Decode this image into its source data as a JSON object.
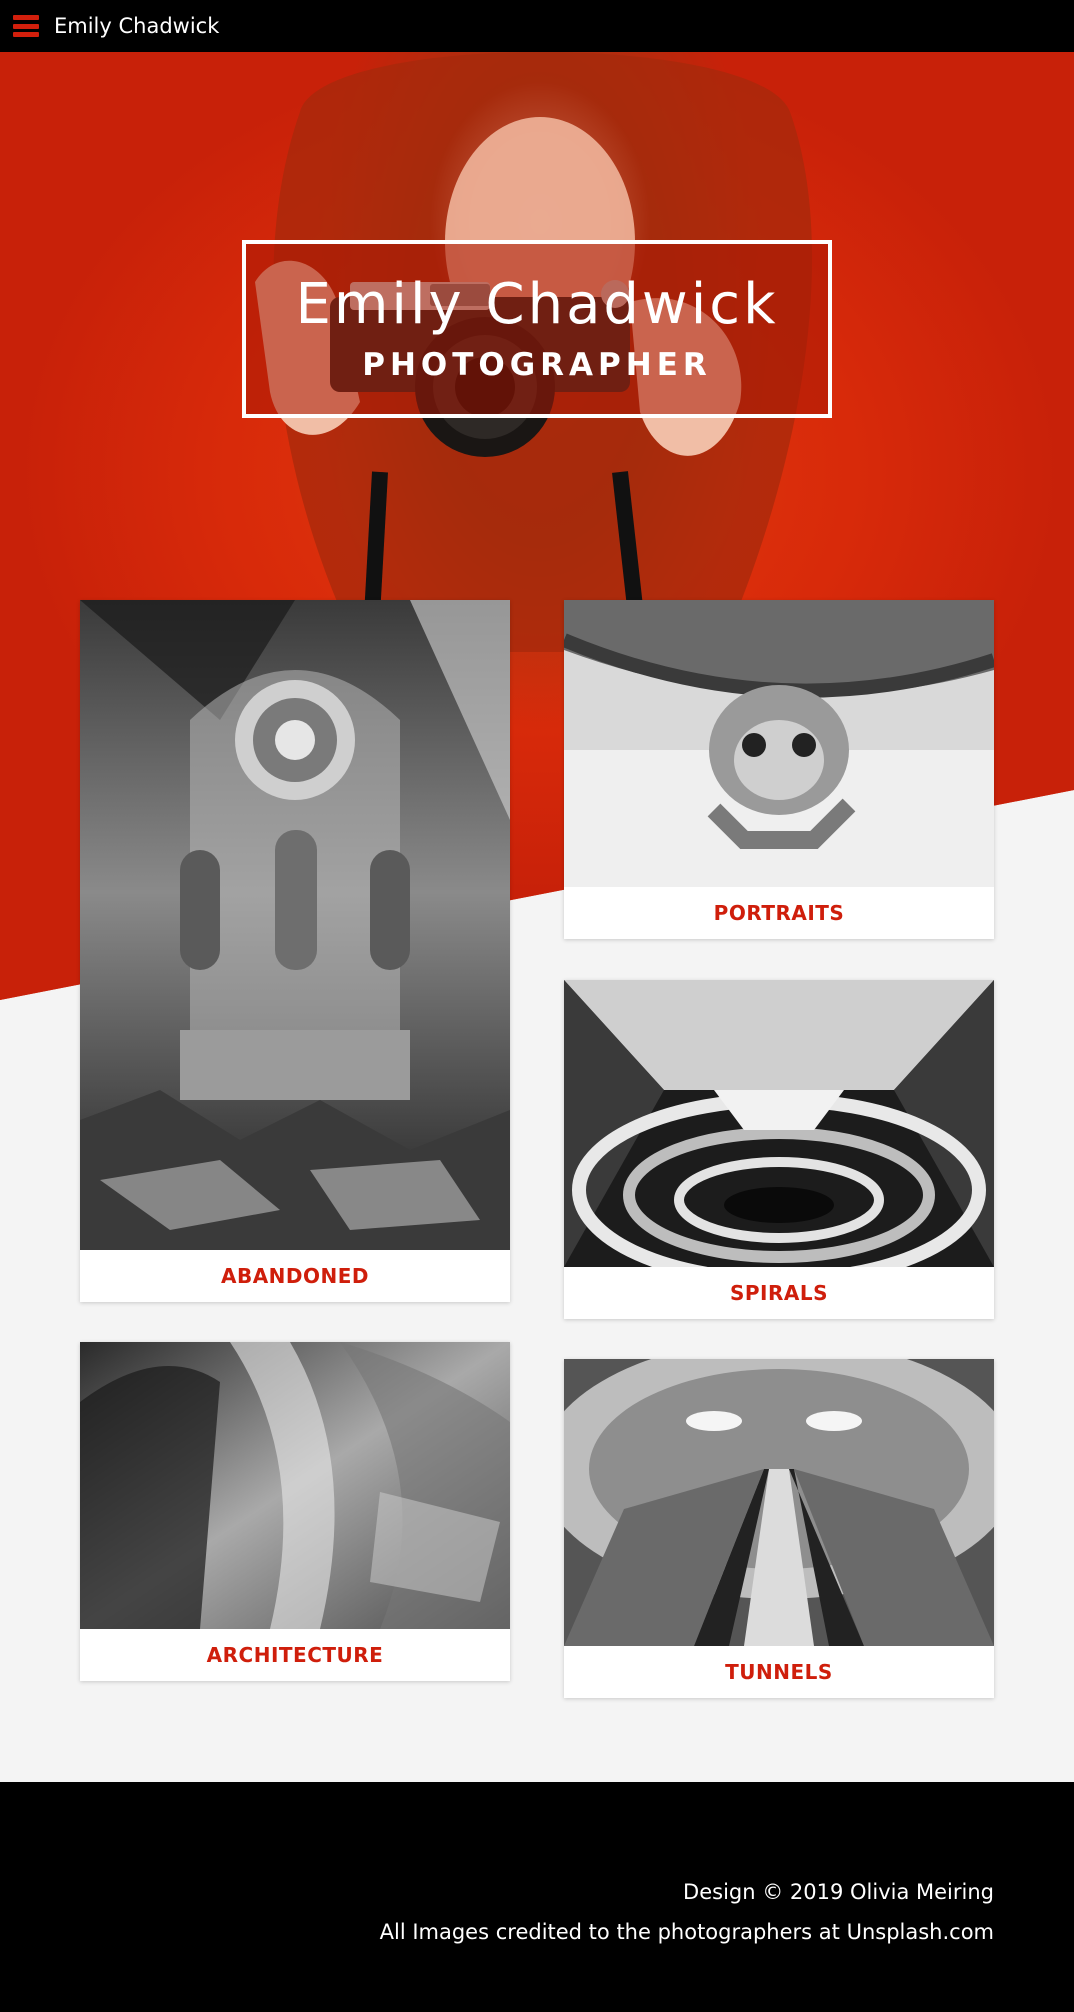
{
  "topbar": {
    "brand": "Emily Chadwick",
    "menu_icon": "hamburger-menu-icon"
  },
  "hero": {
    "name": "Emily Chadwick",
    "role": "PHOTOGRAPHER"
  },
  "gallery": [
    {
      "label": "ABANDONED"
    },
    {
      "label": "PORTRAITS"
    },
    {
      "label": "SPIRALS"
    },
    {
      "label": "ARCHITECTURE"
    },
    {
      "label": "TUNNELS"
    }
  ],
  "footer": {
    "line1": "Design © 2019 Olivia Meiring",
    "line2": "All Images credited to the photographers at Unsplash.com"
  },
  "colors": {
    "accent": "#cf1e0b",
    "hero_red": "#d8250c",
    "bar": "#000000",
    "page_bg": "#f4f4f4"
  }
}
